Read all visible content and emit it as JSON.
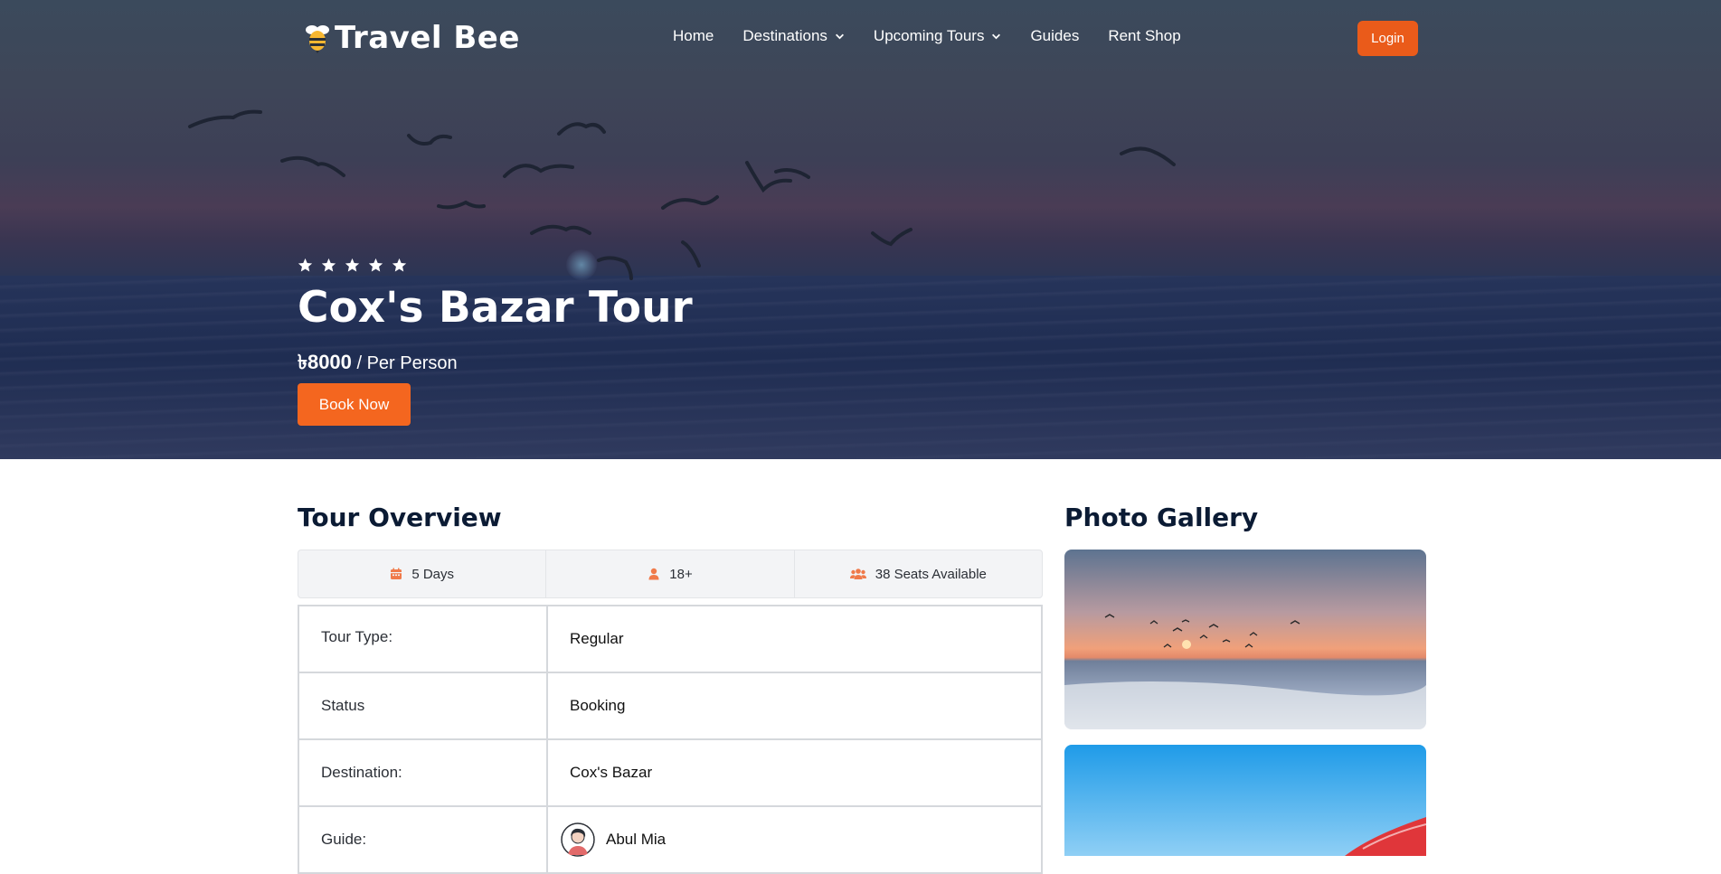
{
  "brand": {
    "name": "Travel Bee"
  },
  "nav": {
    "items": [
      {
        "label": "Home",
        "dropdown": false
      },
      {
        "label": "Destinations",
        "dropdown": true
      },
      {
        "label": "Upcoming Tours",
        "dropdown": true
      },
      {
        "label": "Guides",
        "dropdown": false
      },
      {
        "label": "Rent Shop",
        "dropdown": false
      }
    ],
    "login_label": "Login"
  },
  "hero": {
    "rating": 5,
    "title": "Cox's Bazar Tour",
    "price": "৳8000",
    "price_suffix": "/ Per Person",
    "book_label": "Book Now"
  },
  "overview": {
    "title": "Tour Overview",
    "info": [
      {
        "icon": "calendar-icon",
        "label": "5 Days"
      },
      {
        "icon": "user-icon",
        "label": "18+"
      },
      {
        "icon": "users-icon",
        "label": "38 Seats Available"
      }
    ],
    "details": [
      {
        "key": "Tour Type:",
        "value": "Regular"
      },
      {
        "key": "Status",
        "value": "Booking"
      },
      {
        "key": "Destination:",
        "value": "Cox's Bazar"
      },
      {
        "key": "Guide:",
        "value": "Abul Mia"
      }
    ]
  },
  "gallery": {
    "title": "Photo Gallery"
  },
  "colors": {
    "accent": "#f4661f",
    "login": "#ea5b1a",
    "heading": "#0b1b34",
    "icon": "#f07a4a"
  }
}
